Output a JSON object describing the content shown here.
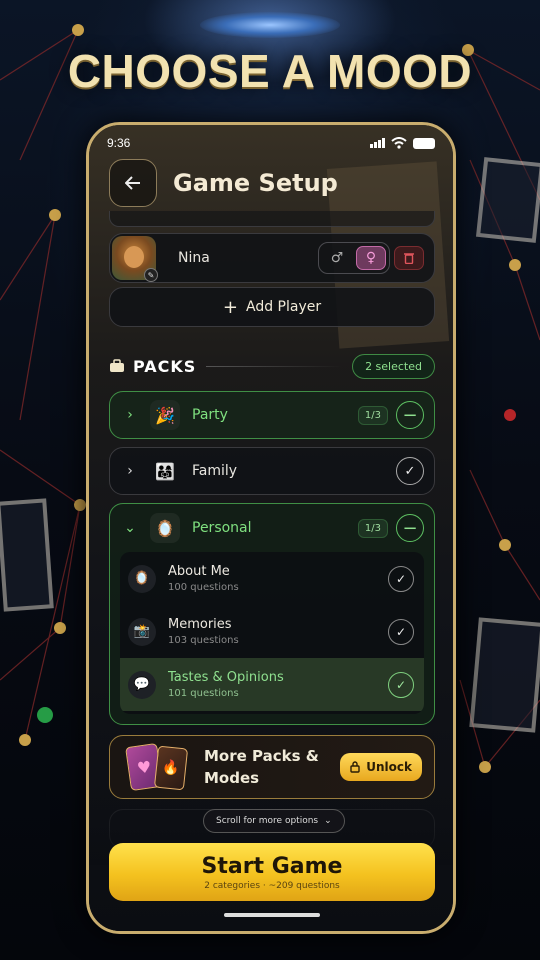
{
  "headline": "CHOOSE A MOOD",
  "status_bar": {
    "time": "9:36"
  },
  "header": {
    "title": "Game Setup"
  },
  "player": {
    "name": "Nina",
    "male_symbol": "♂",
    "female_symbol": "♀"
  },
  "add_player": {
    "label": "Add Player",
    "icon": "+"
  },
  "packs": {
    "label": "PACKS",
    "selected_badge": "2 selected",
    "items": [
      {
        "name": "Party",
        "icon": "🎉",
        "fraction": "1/3",
        "state": "partial"
      },
      {
        "name": "Family",
        "icon": "👨‍👩‍👧",
        "state": "selected"
      },
      {
        "name": "Personal",
        "icon": "🪞",
        "fraction": "1/3",
        "state": "partial",
        "expanded": true
      }
    ],
    "personal_subs": [
      {
        "title": "About Me",
        "count": "100 questions",
        "icon": "🪞",
        "selected": false
      },
      {
        "title": "Memories",
        "count": "103 questions",
        "icon": "📸",
        "selected": false
      },
      {
        "title": "Tastes & Opinions",
        "count": "101 questions",
        "icon": "💬",
        "selected": true
      }
    ]
  },
  "more_packs": {
    "line1": "More Packs &",
    "line2": "Modes",
    "unlock_label": "Unlock"
  },
  "scroll_hint": "Scroll for more options",
  "start": {
    "label": "Start Game",
    "summary": "2 categories · ~209 questions"
  },
  "colors": {
    "accent_gold": "#f4c21f",
    "accent_green": "#5dc062",
    "female_pink": "#c36aa7"
  }
}
